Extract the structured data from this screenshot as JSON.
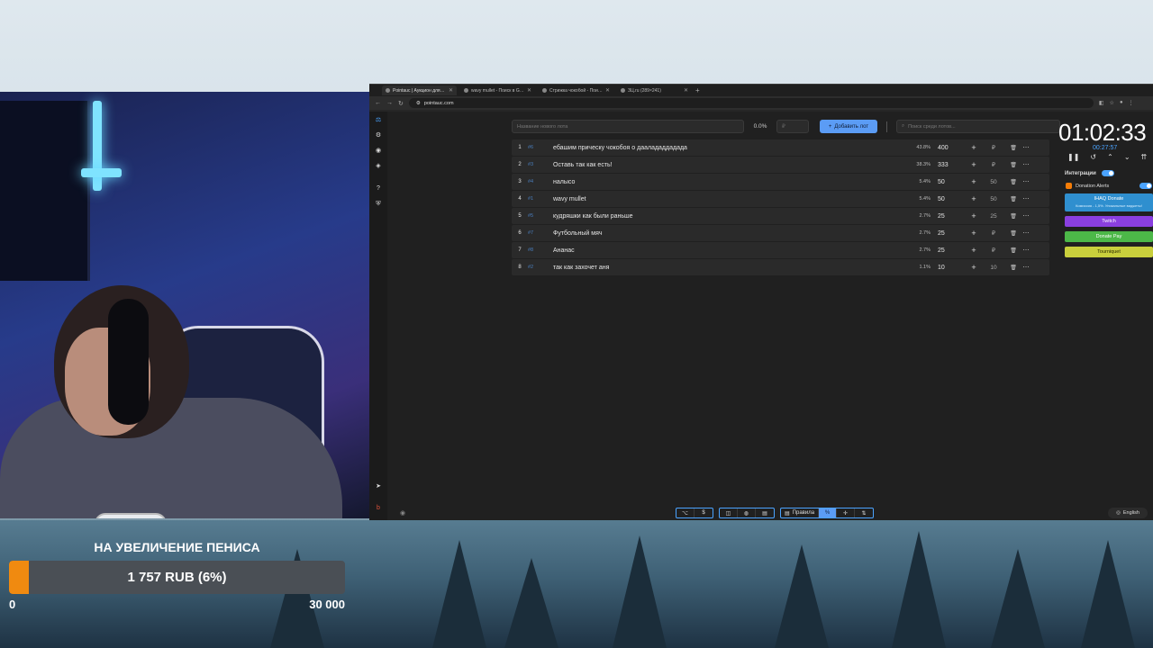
{
  "browser": {
    "tabs": [
      {
        "label": "Pointauc | Аукцион для стримеров",
        "active": true
      },
      {
        "label": "wavy mullet - Поиск в Google",
        "active": false
      },
      {
        "label": "Стрижка чокобой - Поиск в Google",
        "active": false
      },
      {
        "label": "ЗЦ.ru (289×241)",
        "active": false
      }
    ],
    "url": "pointauc.com"
  },
  "new_lot": {
    "name_placeholder": "Название нового лота",
    "percent": "0.0%",
    "price_placeholder": "₽",
    "add_button": "Добавить лот",
    "search_placeholder": "Поиск среди лотов..."
  },
  "lots": [
    {
      "num": "1",
      "fast_id": "#6",
      "name": "ебашим прическу чокобоя о даалададдадада",
      "share": "43.8%",
      "amount": "400",
      "added": "₽"
    },
    {
      "num": "2",
      "fast_id": "#3",
      "name": "Оставь так как есть!",
      "share": "38.3%",
      "amount": "333",
      "added": "₽"
    },
    {
      "num": "3",
      "fast_id": "#4",
      "name": "налысо",
      "share": "5.4%",
      "amount": "50",
      "added": "50"
    },
    {
      "num": "4",
      "fast_id": "#1",
      "name": "wavy mullet",
      "share": "5.4%",
      "amount": "50",
      "added": "50"
    },
    {
      "num": "5",
      "fast_id": "#5",
      "name": "кудряшки как были раньше",
      "share": "2.7%",
      "amount": "25",
      "added": "25"
    },
    {
      "num": "6",
      "fast_id": "#7",
      "name": "Футбольный мяч",
      "share": "2.7%",
      "amount": "25",
      "added": "₽"
    },
    {
      "num": "7",
      "fast_id": "#8",
      "name": "Ананас",
      "share": "2.7%",
      "amount": "25",
      "added": "₽"
    },
    {
      "num": "8",
      "fast_id": "#2",
      "name": "так как захочет аня",
      "share": "1.1%",
      "amount": "10",
      "added": "10"
    }
  ],
  "timer": {
    "main": "01:02:33",
    "sub": "00:27:57"
  },
  "integrations": {
    "title": "Интеграции",
    "donation_alerts": "Donation Alerts",
    "ihaq": "IHAQ Donate",
    "ihaq_sub": "Комиссия - 1,5%. Уникальные виджеты!",
    "twitch": "Twitch",
    "donatepay": "Donate Pay",
    "tourniquet": "Tourniquet"
  },
  "footer": {
    "rules": "Правила",
    "language": "English"
  },
  "goal": {
    "title": "НА УВЕЛИЧЕНИЕ ПЕНИСА",
    "progress_text": "1 757 RUB (6%)",
    "progress_fraction": 0.06,
    "min": "0",
    "max": "30 000"
  },
  "colors": {
    "accent": "#5b9cf5",
    "goal_fill": "#f08a10",
    "twitch": "#8a3fe0",
    "donatepay": "#4cb848",
    "tourniquet": "#c9cf3c",
    "ihaq": "#2f8fcf"
  }
}
